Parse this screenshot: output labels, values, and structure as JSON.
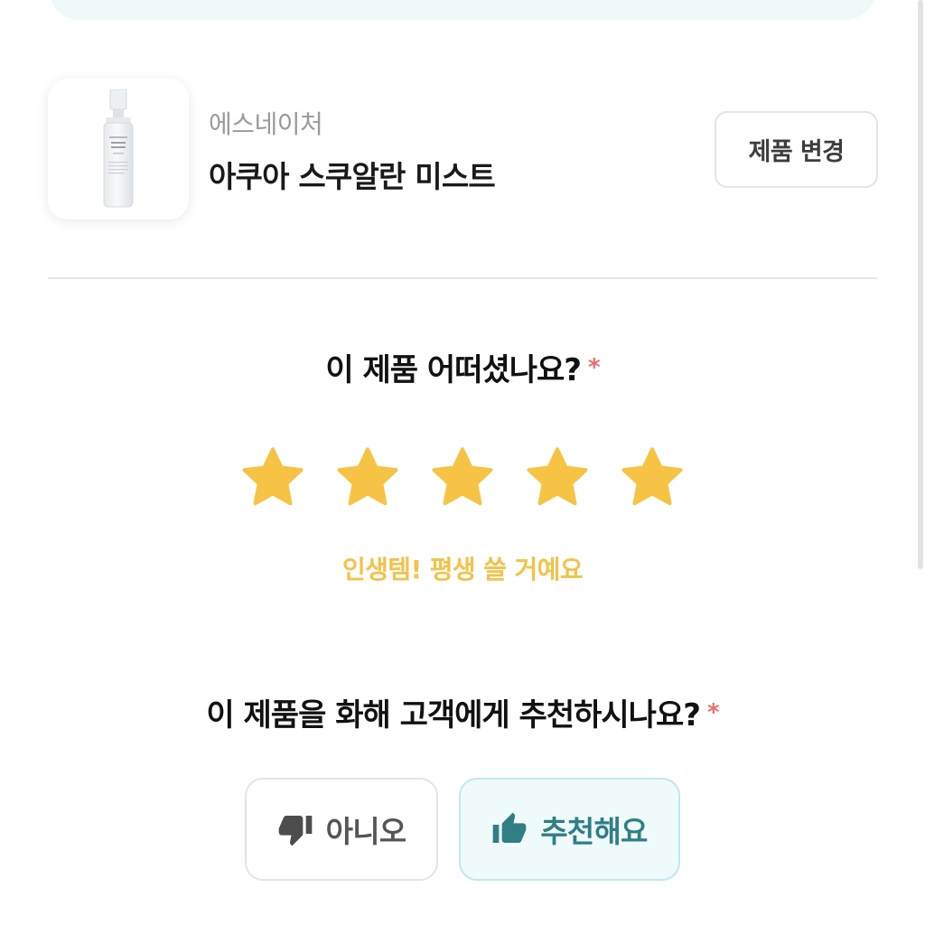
{
  "product": {
    "brand": "에스네이처",
    "name": "아쿠아 스쿠알란 미스트",
    "change_button": "제품 변경",
    "bottle_text": "ACTURE AQUA SQUALANE MIST"
  },
  "rating": {
    "question": "이 제품 어떠셨나요?",
    "required_mark": "*",
    "value": 5,
    "max": 5,
    "label": "인생템! 평생 쓸 거예요"
  },
  "recommend": {
    "question": "이 제품을 화해 고객에게 추천하시나요?",
    "required_mark": "*",
    "no_label": "아니오",
    "yes_label": "추천해요",
    "selected": "yes"
  },
  "colors": {
    "star": "#f6c345",
    "rating_text": "#f3c24a",
    "required": "#f26b6b",
    "recommend_accent": "#2f7f85",
    "recommend_bg": "#effafb"
  },
  "icons": {
    "star": "star-icon",
    "thumbs_down": "thumbs-down-icon",
    "thumbs_up": "thumbs-up-icon"
  }
}
